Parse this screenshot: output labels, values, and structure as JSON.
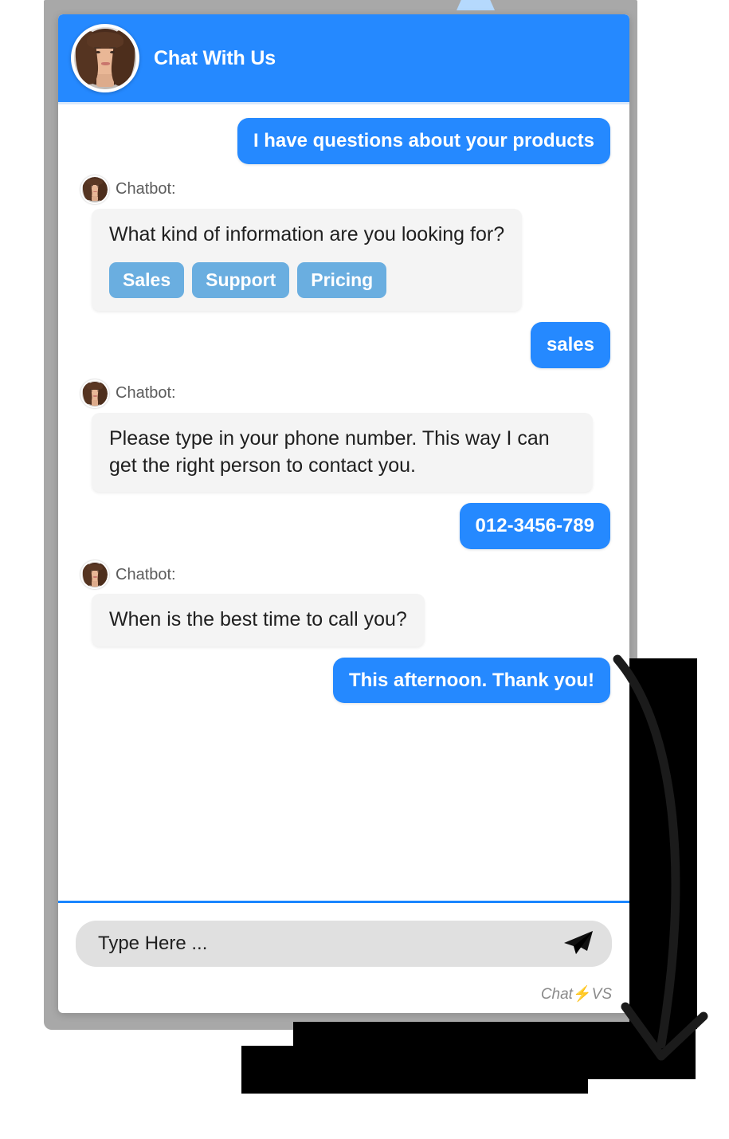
{
  "widget": {
    "header": {
      "title": "Chat With Us",
      "avatar_name": "agent-avatar"
    },
    "messages": [
      {
        "role": "user",
        "text": "I have questions about your products"
      },
      {
        "role": "bot",
        "sender_label": "Chatbot:",
        "text": "What kind of information are you looking for?",
        "quick_replies": [
          "Sales",
          "Support",
          "Pricing"
        ]
      },
      {
        "role": "user",
        "text": "sales"
      },
      {
        "role": "bot",
        "sender_label": "Chatbot:",
        "text": "Please type in your phone number. This way I can get the right person to contact you."
      },
      {
        "role": "user",
        "text": "012-3456-789"
      },
      {
        "role": "bot",
        "sender_label": "Chatbot:",
        "text": "When is the best time to call you?"
      },
      {
        "role": "user",
        "text": "This afternoon. Thank you!"
      }
    ],
    "composer": {
      "placeholder": "Type Here ...",
      "value": "",
      "send_icon": "send-paper-plane-icon"
    },
    "branding": {
      "prefix": "Chat",
      "bolt": "⚡",
      "suffix": "VS"
    }
  },
  "colors": {
    "header_blue": "#2589ff",
    "user_bubble_blue": "#2589ff",
    "quick_reply_blue": "#6aaee0",
    "bot_bubble_gray": "#f4f4f4",
    "frame_gray": "#a8a8a8",
    "divider_blue": "#1a86ff",
    "bolt_orange": "#ff9900",
    "tab_light_blue": "#b5d9fd"
  },
  "annotation": {
    "arrow": "curved-down-arrow",
    "redacted": true
  }
}
